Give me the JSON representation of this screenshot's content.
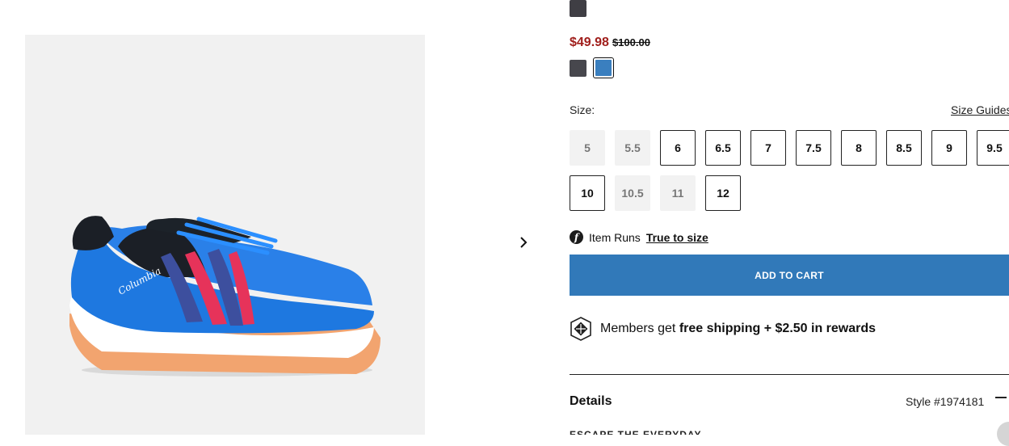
{
  "product": {
    "price_sale": "$49.98",
    "price_original": "$100.00",
    "colors": [
      {
        "name": "dark-grey",
        "hex": "#47474d"
      },
      {
        "name": "blue",
        "hex": "#3a7fbf",
        "selected": true
      }
    ]
  },
  "size": {
    "label": "Size:",
    "guides_link": "Size Guides",
    "options": [
      {
        "label": "5",
        "available": false
      },
      {
        "label": "5.5",
        "available": false
      },
      {
        "label": "6",
        "available": true
      },
      {
        "label": "6.5",
        "available": true
      },
      {
        "label": "7",
        "available": true
      },
      {
        "label": "7.5",
        "available": true
      },
      {
        "label": "8",
        "available": true
      },
      {
        "label": "8.5",
        "available": true
      },
      {
        "label": "9",
        "available": true
      },
      {
        "label": "9.5",
        "available": true
      },
      {
        "label": "10",
        "available": true
      },
      {
        "label": "10.5",
        "available": false
      },
      {
        "label": "11",
        "available": false
      },
      {
        "label": "12",
        "available": true
      }
    ]
  },
  "fit": {
    "prefix": "Item Runs",
    "link": "True to size"
  },
  "cart": {
    "button_label": "ADD TO CART"
  },
  "members": {
    "prefix": "Members get",
    "bold": "free shipping + $2.50 in rewards"
  },
  "details": {
    "title": "Details",
    "style": "Style #1974181",
    "cutoff_text": "ESCAPE THE EVERYDAY"
  },
  "image": {
    "brand_on_shoe": "Columbia"
  },
  "colors_theme": {
    "sale_red": "#a01f1c",
    "cart_blue": "#3179b9"
  }
}
